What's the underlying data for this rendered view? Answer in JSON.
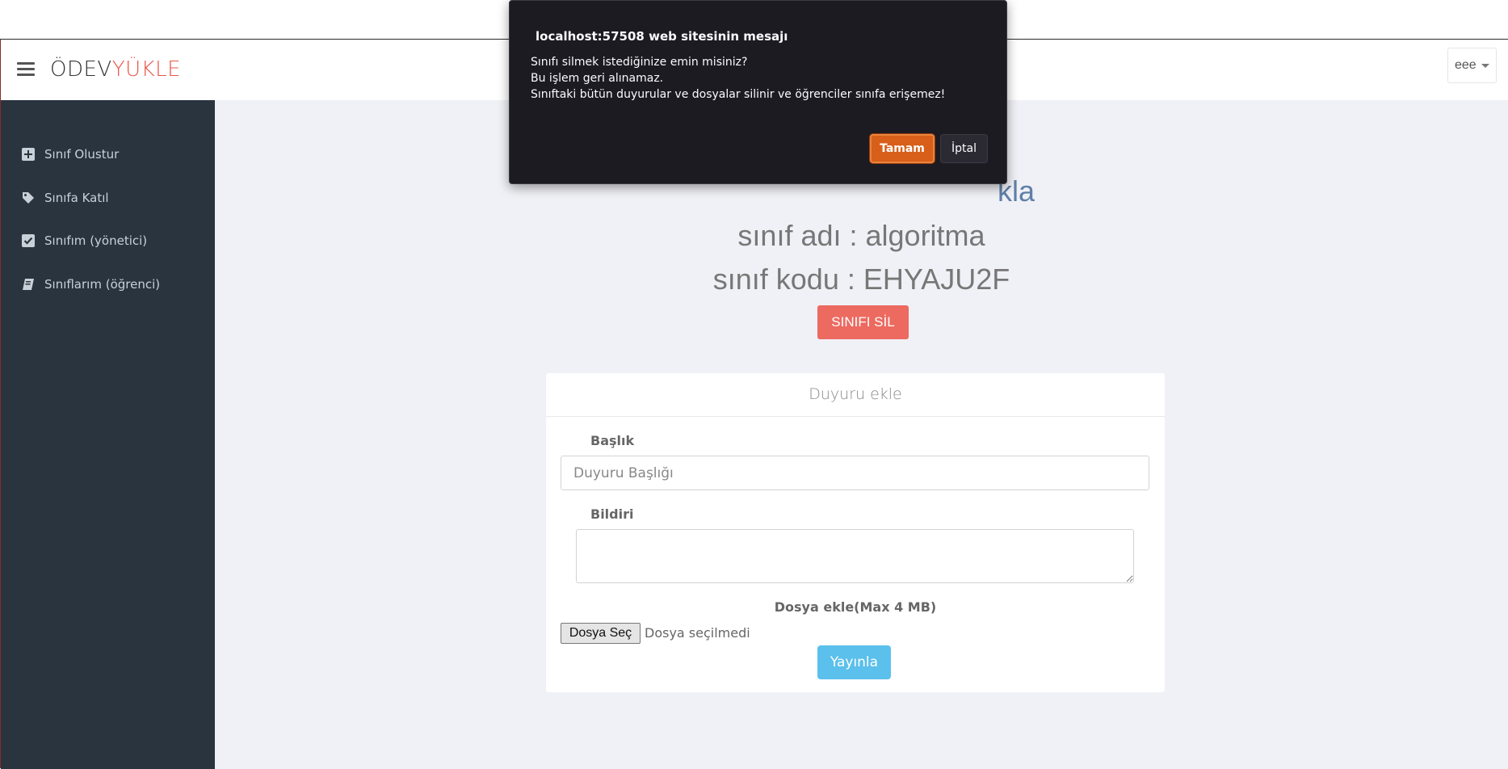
{
  "header": {
    "brand_part1": "ÖDEV",
    "brand_part2": "YÜKLE",
    "user_label": "eee"
  },
  "sidebar": {
    "items": [
      {
        "label": "Sınıf Olustur",
        "icon": "plus-square-icon"
      },
      {
        "label": "Sınıfa Katıl",
        "icon": "tag-icon"
      },
      {
        "label": "Sınıfım (yönetici)",
        "icon": "check-square-icon"
      },
      {
        "label": "Sınıflarım (öğrenci)",
        "icon": "book-icon"
      }
    ]
  },
  "main": {
    "title_line1_tail": "kla",
    "title_line2": "sınıf adı : algoritma",
    "title_line3": "sınıf kodu : EHYAJU2F",
    "delete_button": "SINIFI SİL"
  },
  "card": {
    "header": "Duyuru ekle",
    "title_label": "Başlık",
    "title_placeholder": "Duyuru Başlığı",
    "body_label": "Bildiri",
    "body_value": "",
    "file_label": "Dosya ekle(Max 4 MB)",
    "file_button": "Dosya Seç",
    "file_status": "Dosya seçilmedi",
    "publish_button": "Yayınla"
  },
  "dialog": {
    "title": "localhost:57508 web sitesinin mesajı",
    "line1": "Sınıfı silmek istediğinize emin misiniz?",
    "line2": "Bu işlem geri alınamaz.",
    "line3": "Sınıftaki bütün duyurular ve dosyalar silinir ve öğrenciler sınıfa erişemez!",
    "ok": "Tamam",
    "cancel": "İptal"
  },
  "colors": {
    "brand_accent": "#e8574a",
    "sidebar_bg": "#29343f",
    "delete_button": "#ec6a60",
    "publish_button": "#5bc0eb",
    "ok_button": "#d75f1a"
  }
}
